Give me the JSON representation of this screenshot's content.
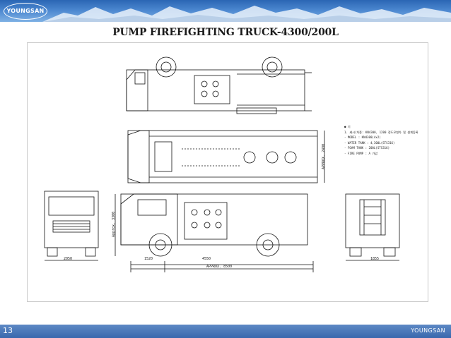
{
  "header": {
    "logo_text": "YOUNGSAN"
  },
  "title": "PUMP FIREFIGHTING TRUCK-4300/200L",
  "notes": {
    "heading": "● 기",
    "lines": [
      "1. 섀시(차종: KN4300, 1200 정도모형차 및 설계등록",
      "- MODEL : KN4300(4x2)",
      "- WATER TANK : 4,300L(STS316)",
      "- FOAM TANK : 200L(STS316)",
      "- FIRE PUMP : A 가압"
    ]
  },
  "dimensions": {
    "front_width": "2050",
    "wheelbase": "4550",
    "front_overhang": "1520",
    "overall_length": "APPROX. 8500",
    "rear_width": "1855",
    "overall_width": "APPROX. 2490",
    "height": "Approx. 3300"
  },
  "footer": {
    "page_number": "13",
    "brand": "YOUNGSAN"
  }
}
